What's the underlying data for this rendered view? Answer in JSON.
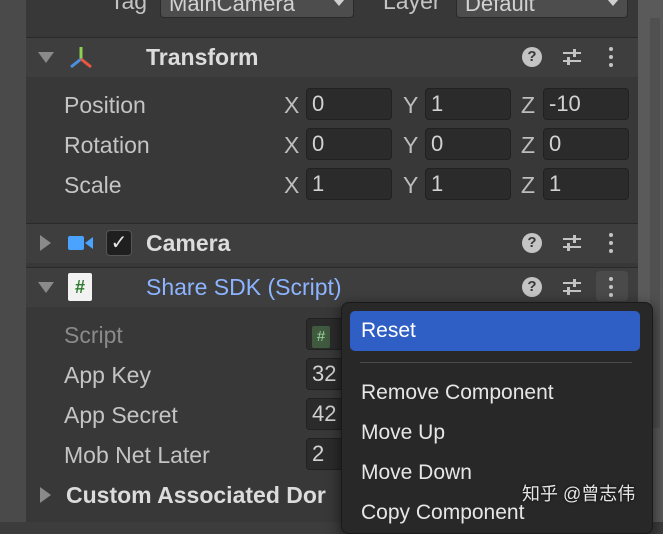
{
  "top_row": {
    "tag_label": "Tag",
    "tag_value": "MainCamera",
    "layer_label": "Layer",
    "layer_value": "Default"
  },
  "transform": {
    "title": "Transform",
    "rows": [
      {
        "label": "Position",
        "x": "0",
        "y": "1",
        "z": "-10"
      },
      {
        "label": "Rotation",
        "x": "0",
        "y": "0",
        "z": "0"
      },
      {
        "label": "Scale",
        "x": "1",
        "y": "1",
        "z": "1"
      }
    ],
    "axes": {
      "x": "X",
      "y": "Y",
      "z": "Z"
    }
  },
  "camera": {
    "title": "Camera",
    "enabled_mark": "✓"
  },
  "script_component": {
    "title": "Share SDK (Script)",
    "badge": "#",
    "fields": [
      {
        "label": "Script",
        "value": "#"
      },
      {
        "label": "App Key",
        "value": "32"
      },
      {
        "label": "App Secret",
        "value": "42"
      },
      {
        "label": "Mob Net Later",
        "value": "2"
      }
    ],
    "custom_foldout": "Custom Associated Dor"
  },
  "context_menu": {
    "items": [
      "Reset",
      "Remove Component",
      "Move Up",
      "Move Down",
      "Copy Component"
    ]
  },
  "header_icons": {
    "help": "?",
    "help_name": "help-icon",
    "preset_name": "preset-sliders-icon",
    "more_name": "more-vertical-icon"
  },
  "watermark": "知乎 @曾志伟",
  "colors": {
    "accent": "#2f5fc4",
    "script_title": "#8cb4ff",
    "panel": "#383838"
  }
}
